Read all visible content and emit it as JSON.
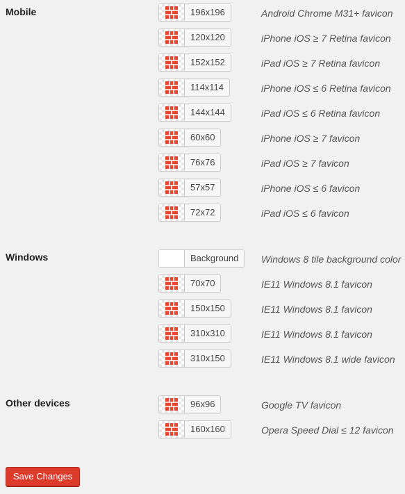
{
  "sections": [
    {
      "label": "Mobile",
      "items": [
        {
          "size": "196x196",
          "desc": "Android Chrome M31+ favicon"
        },
        {
          "size": "120x120",
          "desc": "iPhone iOS ≥ 7 Retina favicon"
        },
        {
          "size": "152x152",
          "desc": "iPad iOS ≥ 7 Retina favicon"
        },
        {
          "size": "114x114",
          "desc": "iPhone iOS ≤ 6 Retina favicon"
        },
        {
          "size": "144x144",
          "desc": "iPad iOS ≤ 6 Retina favicon"
        },
        {
          "size": "60x60",
          "desc": "iPhone iOS ≥ 7 favicon"
        },
        {
          "size": "76x76",
          "desc": "iPad iOS ≥ 7 favicon"
        },
        {
          "size": "57x57",
          "desc": "iPhone iOS ≤ 6 favicon"
        },
        {
          "size": "72x72",
          "desc": "iPad iOS ≤ 6 favicon"
        }
      ]
    },
    {
      "label": "Windows",
      "items": [
        {
          "size": "Background",
          "desc": "Windows 8 tile background color",
          "blank": true
        },
        {
          "size": "70x70",
          "desc": "IE11 Windows 8.1 favicon"
        },
        {
          "size": "150x150",
          "desc": "IE11 Windows 8.1 favicon"
        },
        {
          "size": "310x310",
          "desc": "IE11 Windows 8.1 favicon"
        },
        {
          "size": "310x150",
          "desc": "IE11 Windows 8.1 wide favicon"
        }
      ]
    },
    {
      "label": "Other devices",
      "items": [
        {
          "size": "96x96",
          "desc": "Google TV favicon"
        },
        {
          "size": "160x160",
          "desc": "Opera Speed Dial ≤ 12 favicon"
        }
      ]
    }
  ],
  "save_button": {
    "label": "Save Changes"
  },
  "colors": {
    "icon": "#e8462f",
    "save_button": "#dd3c2c"
  },
  "icon_name": "favicon-thumbnail-icon"
}
